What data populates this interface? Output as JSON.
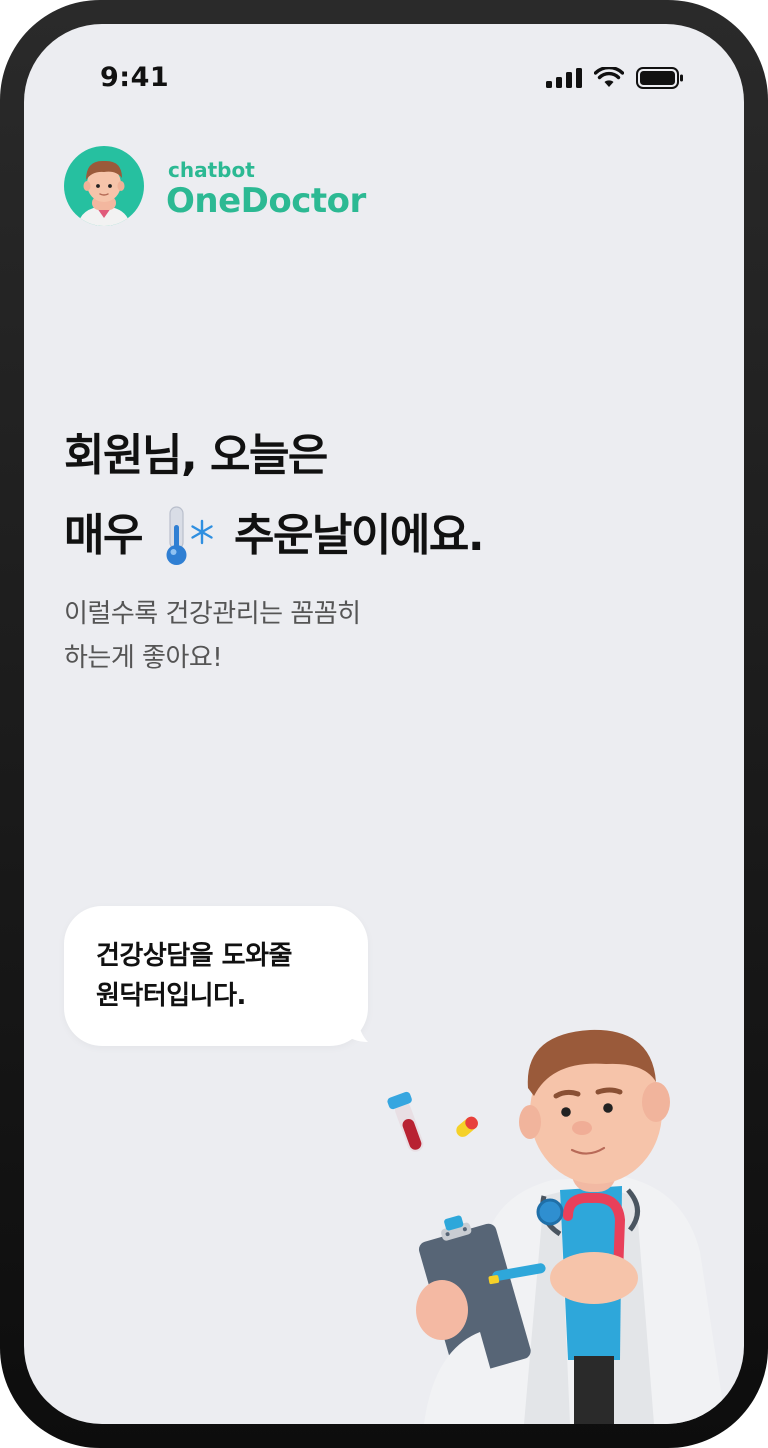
{
  "status_bar": {
    "time": "9:41"
  },
  "brand": {
    "subtitle": "chatbot",
    "name": "OneDoctor"
  },
  "headline": {
    "line1": "회원님, 오늘은",
    "line2_prefix": "매우",
    "line2_suffix": "추운날이에요.",
    "weather_icon": "thermometer-snowflake-icon"
  },
  "subtext": {
    "line1": "이럴수록 건강관리는 꼼꼼히",
    "line2": "하는게 좋아요!"
  },
  "bubble": {
    "line1": "건강상담을 도와줄",
    "line2": "원닥터입니다."
  },
  "colors": {
    "brand_green": "#2cb993",
    "background": "#ecedf1",
    "text_dark": "#111111",
    "text_muted": "#555555"
  }
}
